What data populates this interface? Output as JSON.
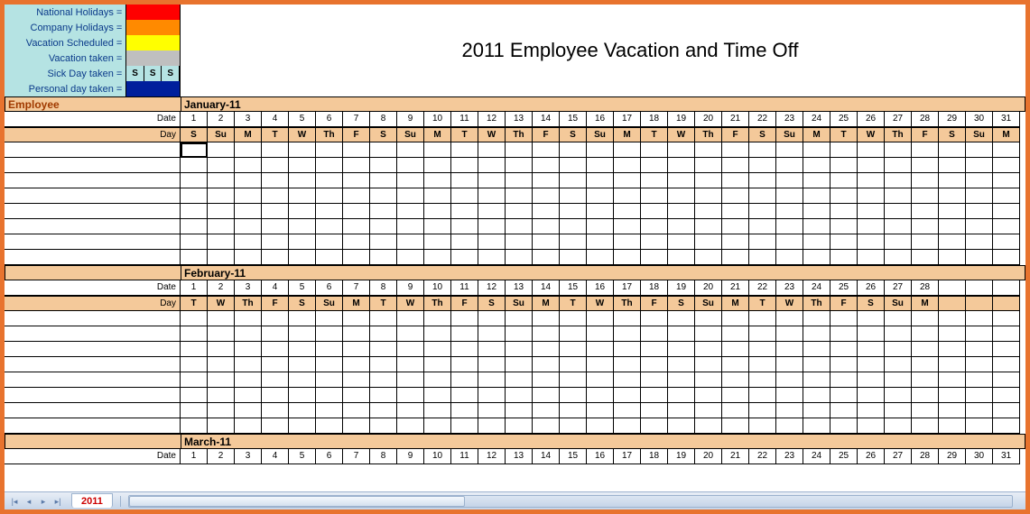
{
  "title": "2011 Employee Vacation and Time Off",
  "legend": [
    {
      "label": "National Holidays =",
      "kind": "solid",
      "color": "#ff0000"
    },
    {
      "label": "Company Holidays =",
      "kind": "solid",
      "color": "#ff8a00"
    },
    {
      "label": "Vacation Scheduled =",
      "kind": "solid",
      "color": "#ffff00"
    },
    {
      "label": "Vacation taken =",
      "kind": "solid",
      "color": "#bfbfbf"
    },
    {
      "label": "Sick Day taken =",
      "kind": "cells",
      "cells": [
        "S",
        "S",
        "S"
      ]
    },
    {
      "label": "Personal day taken =",
      "kind": "solid",
      "color": "#001f9c"
    }
  ],
  "employee_header": "Employee",
  "date_label": "Date",
  "day_label": "Day",
  "months": [
    {
      "name": "January-11",
      "dates": [
        1,
        2,
        3,
        4,
        5,
        6,
        7,
        8,
        9,
        10,
        11,
        12,
        13,
        14,
        15,
        16,
        17,
        18,
        19,
        20,
        21,
        22,
        23,
        24,
        25,
        26,
        27,
        28,
        29,
        30,
        31
      ],
      "days": [
        "S",
        "Su",
        "M",
        "T",
        "W",
        "Th",
        "F",
        "S",
        "Su",
        "M",
        "T",
        "W",
        "Th",
        "F",
        "S",
        "Su",
        "M",
        "T",
        "W",
        "Th",
        "F",
        "S",
        "Su",
        "M",
        "T",
        "W",
        "Th",
        "F",
        "S",
        "Su",
        "M"
      ],
      "blank_rows": 8
    },
    {
      "name": "February-11",
      "dates": [
        1,
        2,
        3,
        4,
        5,
        6,
        7,
        8,
        9,
        10,
        11,
        12,
        13,
        14,
        15,
        16,
        17,
        18,
        19,
        20,
        21,
        22,
        23,
        24,
        25,
        26,
        27,
        28
      ],
      "days": [
        "T",
        "W",
        "Th",
        "F",
        "S",
        "Su",
        "M",
        "T",
        "W",
        "Th",
        "F",
        "S",
        "Su",
        "M",
        "T",
        "W",
        "Th",
        "F",
        "S",
        "Su",
        "M",
        "T",
        "W",
        "Th",
        "F",
        "S",
        "Su",
        "M"
      ],
      "blank_rows": 8
    },
    {
      "name": "March-11",
      "dates": [
        1,
        2,
        3,
        4,
        5,
        6,
        7,
        8,
        9,
        10,
        11,
        12,
        13,
        14,
        15,
        16,
        17,
        18,
        19,
        20,
        21,
        22,
        23,
        24,
        25,
        26,
        27,
        28,
        29,
        30,
        31
      ],
      "days": [],
      "blank_rows": 0
    }
  ],
  "tab": {
    "name": "2011"
  },
  "grid_cols": 31
}
